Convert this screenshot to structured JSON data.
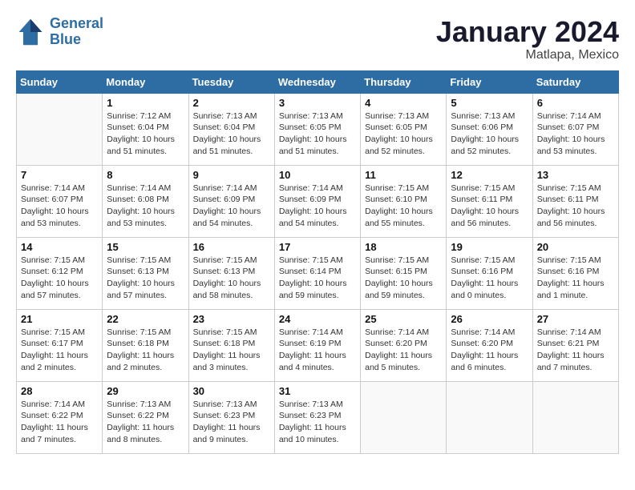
{
  "header": {
    "logo_line1": "General",
    "logo_line2": "Blue",
    "month": "January 2024",
    "location": "Matlapa, Mexico"
  },
  "days_of_week": [
    "Sunday",
    "Monday",
    "Tuesday",
    "Wednesday",
    "Thursday",
    "Friday",
    "Saturday"
  ],
  "weeks": [
    [
      {
        "day": "",
        "info": ""
      },
      {
        "day": "1",
        "info": "Sunrise: 7:12 AM\nSunset: 6:04 PM\nDaylight: 10 hours\nand 51 minutes."
      },
      {
        "day": "2",
        "info": "Sunrise: 7:13 AM\nSunset: 6:04 PM\nDaylight: 10 hours\nand 51 minutes."
      },
      {
        "day": "3",
        "info": "Sunrise: 7:13 AM\nSunset: 6:05 PM\nDaylight: 10 hours\nand 51 minutes."
      },
      {
        "day": "4",
        "info": "Sunrise: 7:13 AM\nSunset: 6:05 PM\nDaylight: 10 hours\nand 52 minutes."
      },
      {
        "day": "5",
        "info": "Sunrise: 7:13 AM\nSunset: 6:06 PM\nDaylight: 10 hours\nand 52 minutes."
      },
      {
        "day": "6",
        "info": "Sunrise: 7:14 AM\nSunset: 6:07 PM\nDaylight: 10 hours\nand 53 minutes."
      }
    ],
    [
      {
        "day": "7",
        "info": "Sunrise: 7:14 AM\nSunset: 6:07 PM\nDaylight: 10 hours\nand 53 minutes."
      },
      {
        "day": "8",
        "info": "Sunrise: 7:14 AM\nSunset: 6:08 PM\nDaylight: 10 hours\nand 53 minutes."
      },
      {
        "day": "9",
        "info": "Sunrise: 7:14 AM\nSunset: 6:09 PM\nDaylight: 10 hours\nand 54 minutes."
      },
      {
        "day": "10",
        "info": "Sunrise: 7:14 AM\nSunset: 6:09 PM\nDaylight: 10 hours\nand 54 minutes."
      },
      {
        "day": "11",
        "info": "Sunrise: 7:15 AM\nSunset: 6:10 PM\nDaylight: 10 hours\nand 55 minutes."
      },
      {
        "day": "12",
        "info": "Sunrise: 7:15 AM\nSunset: 6:11 PM\nDaylight: 10 hours\nand 56 minutes."
      },
      {
        "day": "13",
        "info": "Sunrise: 7:15 AM\nSunset: 6:11 PM\nDaylight: 10 hours\nand 56 minutes."
      }
    ],
    [
      {
        "day": "14",
        "info": "Sunrise: 7:15 AM\nSunset: 6:12 PM\nDaylight: 10 hours\nand 57 minutes."
      },
      {
        "day": "15",
        "info": "Sunrise: 7:15 AM\nSunset: 6:13 PM\nDaylight: 10 hours\nand 57 minutes."
      },
      {
        "day": "16",
        "info": "Sunrise: 7:15 AM\nSunset: 6:13 PM\nDaylight: 10 hours\nand 58 minutes."
      },
      {
        "day": "17",
        "info": "Sunrise: 7:15 AM\nSunset: 6:14 PM\nDaylight: 10 hours\nand 59 minutes."
      },
      {
        "day": "18",
        "info": "Sunrise: 7:15 AM\nSunset: 6:15 PM\nDaylight: 10 hours\nand 59 minutes."
      },
      {
        "day": "19",
        "info": "Sunrise: 7:15 AM\nSunset: 6:16 PM\nDaylight: 11 hours\nand 0 minutes."
      },
      {
        "day": "20",
        "info": "Sunrise: 7:15 AM\nSunset: 6:16 PM\nDaylight: 11 hours\nand 1 minute."
      }
    ],
    [
      {
        "day": "21",
        "info": "Sunrise: 7:15 AM\nSunset: 6:17 PM\nDaylight: 11 hours\nand 2 minutes."
      },
      {
        "day": "22",
        "info": "Sunrise: 7:15 AM\nSunset: 6:18 PM\nDaylight: 11 hours\nand 2 minutes."
      },
      {
        "day": "23",
        "info": "Sunrise: 7:15 AM\nSunset: 6:18 PM\nDaylight: 11 hours\nand 3 minutes."
      },
      {
        "day": "24",
        "info": "Sunrise: 7:14 AM\nSunset: 6:19 PM\nDaylight: 11 hours\nand 4 minutes."
      },
      {
        "day": "25",
        "info": "Sunrise: 7:14 AM\nSunset: 6:20 PM\nDaylight: 11 hours\nand 5 minutes."
      },
      {
        "day": "26",
        "info": "Sunrise: 7:14 AM\nSunset: 6:20 PM\nDaylight: 11 hours\nand 6 minutes."
      },
      {
        "day": "27",
        "info": "Sunrise: 7:14 AM\nSunset: 6:21 PM\nDaylight: 11 hours\nand 7 minutes."
      }
    ],
    [
      {
        "day": "28",
        "info": "Sunrise: 7:14 AM\nSunset: 6:22 PM\nDaylight: 11 hours\nand 7 minutes."
      },
      {
        "day": "29",
        "info": "Sunrise: 7:13 AM\nSunset: 6:22 PM\nDaylight: 11 hours\nand 8 minutes."
      },
      {
        "day": "30",
        "info": "Sunrise: 7:13 AM\nSunset: 6:23 PM\nDaylight: 11 hours\nand 9 minutes."
      },
      {
        "day": "31",
        "info": "Sunrise: 7:13 AM\nSunset: 6:23 PM\nDaylight: 11 hours\nand 10 minutes."
      },
      {
        "day": "",
        "info": ""
      },
      {
        "day": "",
        "info": ""
      },
      {
        "day": "",
        "info": ""
      }
    ]
  ]
}
